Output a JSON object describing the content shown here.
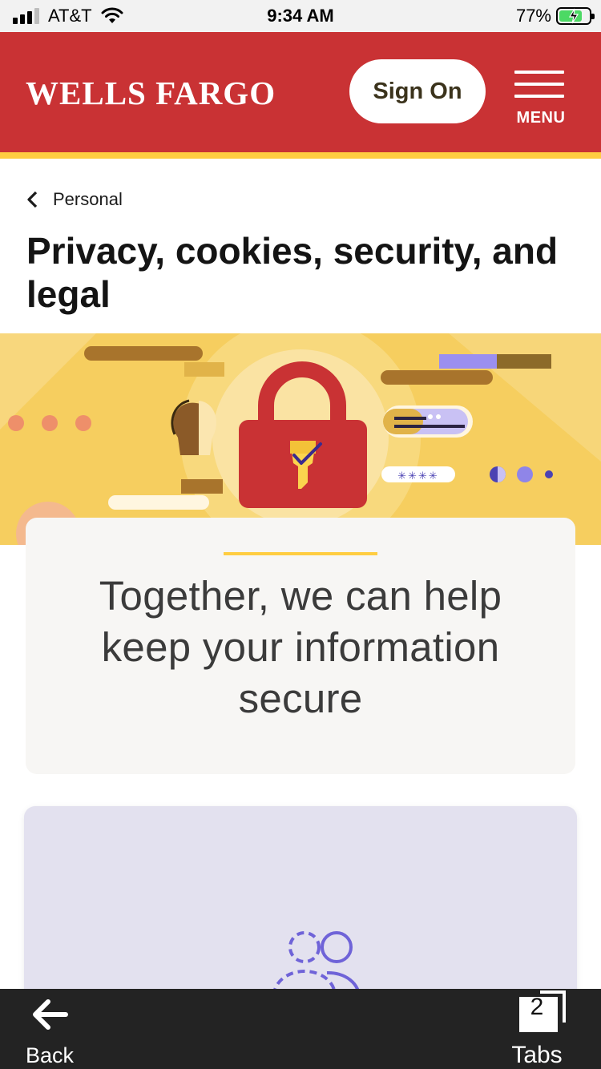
{
  "status_bar": {
    "carrier": "AT&T",
    "time": "9:34 AM",
    "battery_percent": "77%",
    "battery_level": 0.77,
    "signal_bars_active": 3,
    "signal_bars_total": 4,
    "icons": [
      "signal-icon",
      "wifi-icon",
      "battery-charging-icon"
    ]
  },
  "header": {
    "logo": "WELLS FARGO",
    "sign_on_label": "Sign On",
    "menu_label": "MENU",
    "colors": {
      "brand_red": "#c93234",
      "brand_yellow": "#ffcd41"
    }
  },
  "breadcrumb": {
    "label": "Personal",
    "icon": "chevron-left-icon"
  },
  "page": {
    "title": "Privacy, cookies, security, and legal"
  },
  "hero": {
    "icons": [
      "padlock-icon",
      "shield-check-icon",
      "person-silhouette-icon",
      "chat-bubble-icon"
    ],
    "password_mask": "✳✳✳✳"
  },
  "callout": {
    "heading": "Together, we can help keep your information secure"
  },
  "info_card": {
    "icon": "people-icon"
  },
  "browser_toolbar": {
    "back_label": "Back",
    "tabs_label": "Tabs",
    "tabs_count": "2"
  }
}
